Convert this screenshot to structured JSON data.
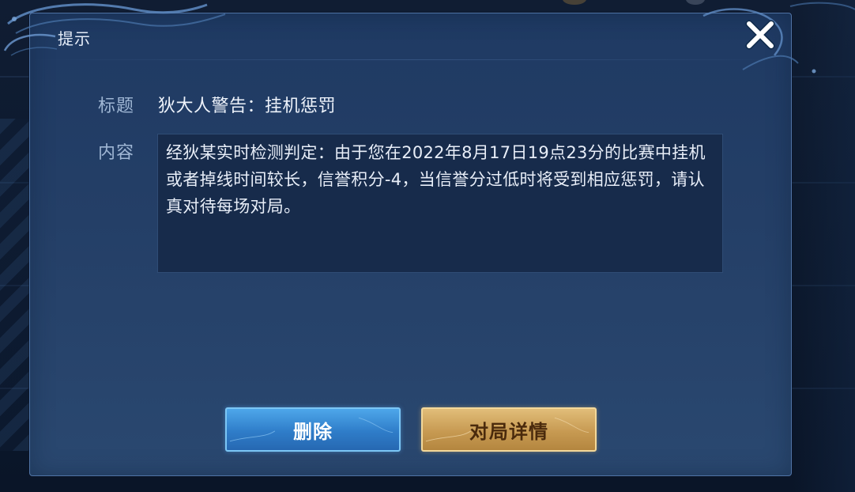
{
  "dialog": {
    "title": "提示",
    "close_icon": "close-x-icon"
  },
  "mail": {
    "title_label": "标题",
    "title_value": "狄大人警告：挂机惩罚",
    "content_label": "内容",
    "content_value": "经狄某实时检测判定：由于您在2022年8月17日19点23分的比赛中挂机或者掉线时间较长，信誉积分-4，当信誉分过低时将受到相应惩罚，请认真对待每场对局。"
  },
  "buttons": {
    "delete_label": "删除",
    "detail_label": "对局详情"
  },
  "colors": {
    "dialog_bg": "#243f67",
    "delete_button": "#3a8fd8",
    "detail_button": "#d4ab62"
  }
}
